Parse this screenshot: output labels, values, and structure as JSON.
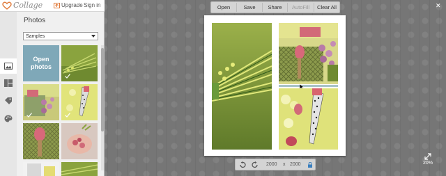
{
  "header": {
    "logo_text": "Collage",
    "upgrade_label": "Upgrade",
    "signin_label": "Sign in"
  },
  "sidebar": {
    "rail": [
      {
        "icon": "photos-icon",
        "active": true
      },
      {
        "icon": "layouts-icon",
        "active": false
      },
      {
        "icon": "tags-icon",
        "active": false
      },
      {
        "icon": "palette-icon",
        "active": false
      }
    ],
    "panel_title": "Photos",
    "source_select": {
      "value": "Samples"
    },
    "open_photos_label": "Open\nphotos"
  },
  "toolbar": {
    "open_label": "Open",
    "save_label": "Save",
    "share_label": "Share",
    "autofill_label": "AutoFill",
    "clear_all_label": "Clear All"
  },
  "canvas": {
    "width_value": "2000",
    "times_label": "x",
    "height_value": "2000"
  },
  "zoom": {
    "label": "20%"
  },
  "colors": {
    "workspace": "#767676",
    "open_photos_tile": "#7fa8b8",
    "accent_orange": "#e07a3a"
  }
}
